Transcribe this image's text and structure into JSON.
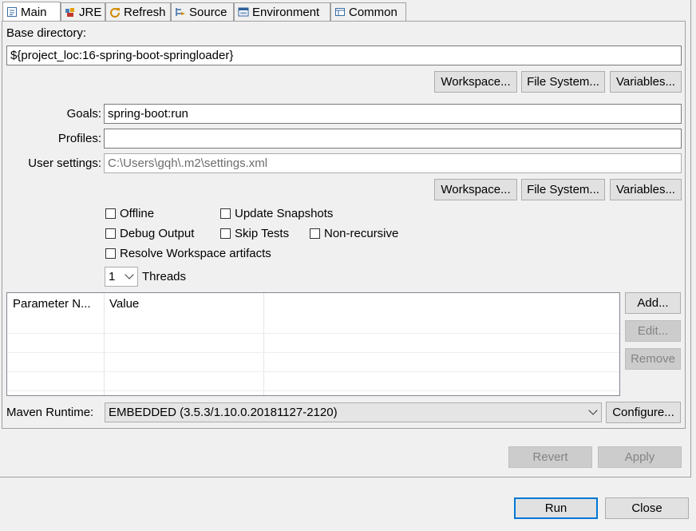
{
  "tabs": [
    {
      "label": "Main",
      "icon": "main-tab-icon",
      "active": true
    },
    {
      "label": "JRE",
      "icon": "jre-icon"
    },
    {
      "label": "Refresh",
      "icon": "refresh-icon"
    },
    {
      "label": "Source",
      "icon": "source-icon"
    },
    {
      "label": "Environment",
      "icon": "environment-icon"
    },
    {
      "label": "Common",
      "icon": "common-icon"
    }
  ],
  "base_directory": {
    "label": "Base directory:",
    "value": "${project_loc:16-spring-boot-springloader}",
    "workspace_label": "Workspace...",
    "filesystem_label": "File System...",
    "variables_label": "Variables..."
  },
  "goals": {
    "label": "Goals:",
    "value": "spring-boot:run"
  },
  "profiles": {
    "label": "Profiles:",
    "value": ""
  },
  "user_settings": {
    "label": "User settings:",
    "placeholder": "C:\\Users\\gqh\\.m2\\settings.xml",
    "workspace_label": "Workspace...",
    "filesystem_label": "File System...",
    "variables_label": "Variables..."
  },
  "options": {
    "offline": "Offline",
    "update_snapshots": "Update Snapshots",
    "debug_output": "Debug Output",
    "skip_tests": "Skip Tests",
    "non_recursive": "Non-recursive",
    "resolve_workspace": "Resolve Workspace artifacts",
    "threads_value": "1",
    "threads_label": "Threads"
  },
  "params_table": {
    "headers": [
      "Parameter N...",
      "Value"
    ],
    "add_label": "Add...",
    "edit_label": "Edit...",
    "remove_label": "Remove"
  },
  "maven_runtime": {
    "label": "Maven Runtime:",
    "value": "EMBEDDED (3.5.3/1.10.0.20181127-2120)",
    "configure_label": "Configure..."
  },
  "footer": {
    "revert_label": "Revert",
    "apply_label": "Apply",
    "run_label": "Run",
    "close_label": "Close"
  }
}
